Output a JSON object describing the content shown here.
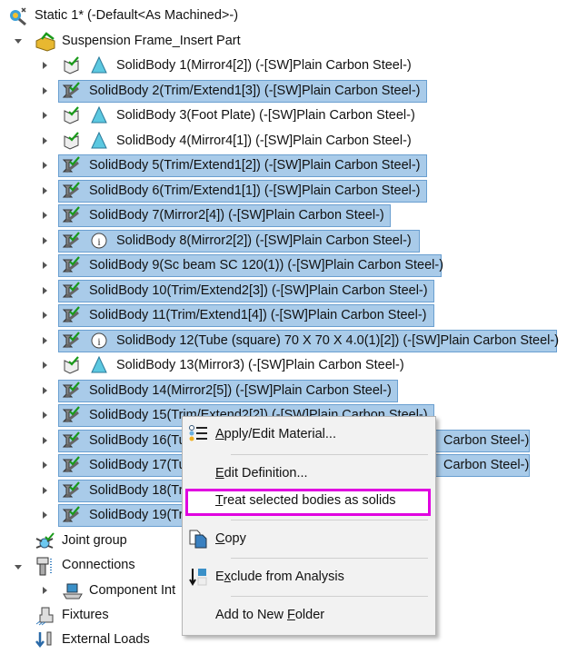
{
  "tree": {
    "root": {
      "label": "Static 1* (-Default<As Machined>-)",
      "icon": "static-study-icon"
    },
    "part": {
      "label": "Suspension Frame_Insert Part",
      "icon": "part-icon"
    },
    "bodies": [
      {
        "label": "SolidBody 1(Mirror4[2]) (-[SW]Plain Carbon Steel-)",
        "selected": false,
        "icon": "solid-body-icon"
      },
      {
        "label": "SolidBody 2(Trim/Extend1[3]) (-[SW]Plain Carbon Steel-)",
        "selected": true,
        "icon": "beam-icon"
      },
      {
        "label": "SolidBody 3(Foot Plate) (-[SW]Plain Carbon Steel-)",
        "selected": false,
        "icon": "solid-body-icon"
      },
      {
        "label": "SolidBody 4(Mirror4[1]) (-[SW]Plain Carbon Steel-)",
        "selected": false,
        "icon": "solid-body-icon"
      },
      {
        "label": "SolidBody 5(Trim/Extend1[2]) (-[SW]Plain Carbon Steel-)",
        "selected": true,
        "icon": "beam-icon"
      },
      {
        "label": "SolidBody 6(Trim/Extend1[1]) (-[SW]Plain Carbon Steel-)",
        "selected": true,
        "icon": "beam-icon"
      },
      {
        "label": "SolidBody 7(Mirror2[4]) (-[SW]Plain Carbon Steel-)",
        "selected": true,
        "icon": "beam-icon"
      },
      {
        "label": "SolidBody 8(Mirror2[2]) (-[SW]Plain Carbon Steel-)",
        "selected": true,
        "icon": "beam-icon",
        "info": true
      },
      {
        "label": "SolidBody 9(Sc beam SC 120(1)) (-[SW]Plain Carbon Steel-)",
        "selected": true,
        "icon": "beam-icon"
      },
      {
        "label": "SolidBody 10(Trim/Extend2[3]) (-[SW]Plain Carbon Steel-)",
        "selected": true,
        "icon": "beam-icon"
      },
      {
        "label": "SolidBody 11(Trim/Extend1[4]) (-[SW]Plain Carbon Steel-)",
        "selected": true,
        "icon": "beam-icon"
      },
      {
        "label": "SolidBody 12(Tube (square) 70 X 70 X 4.0(1)[2]) (-[SW]Plain Carbon Steel-)",
        "selected": true,
        "icon": "beam-icon",
        "info": true
      },
      {
        "label": "SolidBody 13(Mirror3) (-[SW]Plain Carbon Steel-)",
        "selected": false,
        "icon": "solid-body-icon"
      },
      {
        "label": "SolidBody 14(Mirror2[5]) (-[SW]Plain Carbon Steel-)",
        "selected": true,
        "icon": "beam-icon"
      },
      {
        "label": "SolidBody 15(Trim/Extend2[2]) (-[SW]Plain Carbon Steel-)",
        "selected": true,
        "icon": "beam-icon"
      },
      {
        "label": "SolidBody 16(Tu",
        "tail": "Carbon Steel-)",
        "selected": true,
        "icon": "beam-icon"
      },
      {
        "label": "SolidBody 17(Tu",
        "tail": "Carbon Steel-)",
        "selected": true,
        "icon": "beam-icon"
      },
      {
        "label": "SolidBody 18(Tr",
        "selected": true,
        "icon": "beam-icon"
      },
      {
        "label": "SolidBody 19(Tr",
        "selected": true,
        "icon": "beam-icon"
      }
    ],
    "joint_group": "Joint group",
    "connections": "Connections",
    "component": "Component Int",
    "fixtures": "Fixtures",
    "external_loads": "External Loads"
  },
  "menu": {
    "items": [
      {
        "pre": "",
        "u": "A",
        "post": "pply/Edit Material...",
        "icon": "material-list-icon"
      },
      {
        "pre": "",
        "u": "E",
        "post": "dit Definition..."
      },
      {
        "pre": "",
        "u": "T",
        "post": "reat selected bodies as solids",
        "highlighted": true
      },
      {
        "pre": "",
        "u": "C",
        "post": "opy",
        "icon": "copy-icon"
      },
      {
        "pre": "E",
        "u": "x",
        "post": "clude from Analysis",
        "icon": "exclude-icon"
      },
      {
        "pre": "Add to New ",
        "u": "F",
        "post": "older"
      }
    ]
  },
  "colors": {
    "selection": "#a9cbe9",
    "highlight_box": "#e000e0"
  }
}
